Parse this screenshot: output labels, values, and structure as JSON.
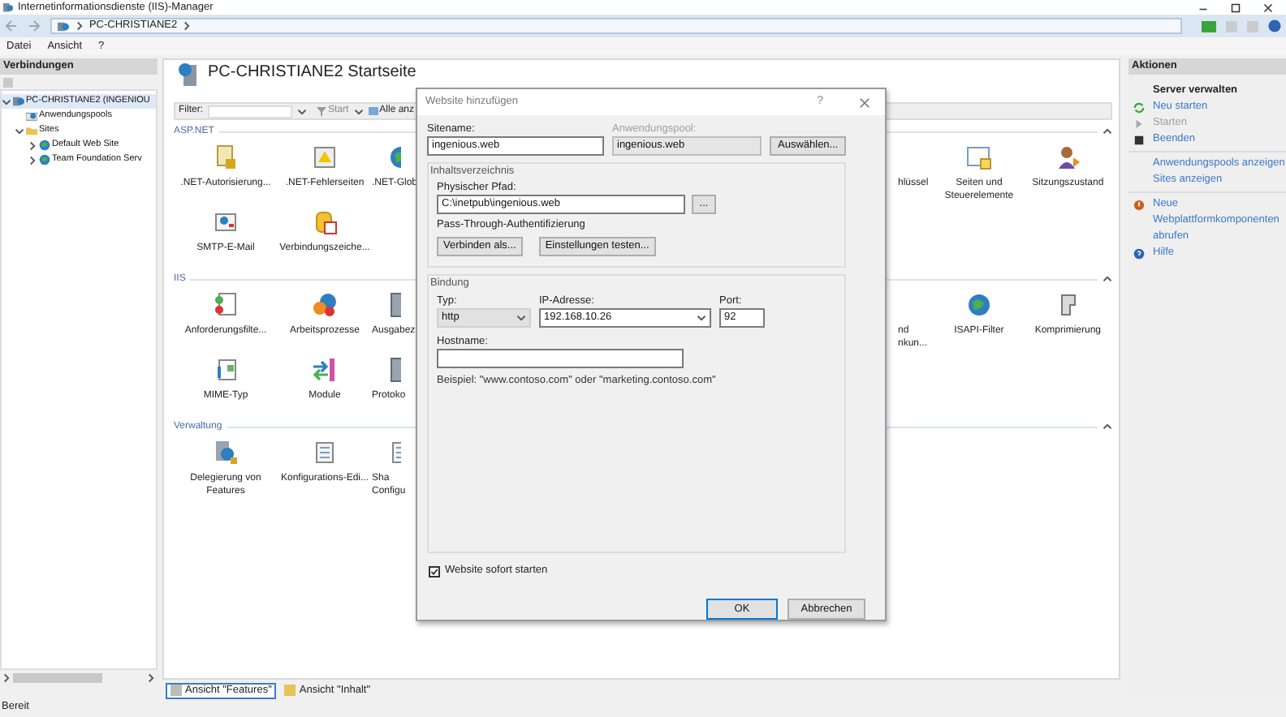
{
  "window": {
    "title": "Internetinformationsdienste (IIS)-Manager"
  },
  "address_bar": {
    "path": [
      {
        "label": "PC-CHRISTIANE2"
      }
    ]
  },
  "menu": [
    "Datei",
    "Ansicht",
    "?"
  ],
  "connections": {
    "title": "Verbindungen",
    "tree": [
      {
        "label": "PC-CHRISTIANE2 (INGENIOU",
        "expanded": true,
        "selected": true,
        "children": [
          {
            "label": "Anwendungspools",
            "selected": false
          },
          {
            "label": "Sites",
            "expanded": true,
            "selected": false,
            "children": [
              {
                "label": "Default Web Site",
                "expanded": false,
                "selected": false
              },
              {
                "label": "Team Foundation Serv",
                "expanded": false,
                "selected": false
              }
            ]
          }
        ]
      }
    ]
  },
  "start_page": {
    "title": "PC-CHRISTIANE2 Startseite",
    "filter": {
      "label": "Filter:",
      "start": "Start",
      "show_all": "Alle anz"
    },
    "groups": [
      {
        "title": "ASP.NET",
        "rows": [
          {
            "left": [
              {
                "label": ".NET-Autorisierung...",
                "kind": "feature"
              },
              {
                "label": ".NET-Fehlerseiten",
                "kind": "feature"
              },
              {
                "label": ".NET-Glob",
                "kind": "partial"
              }
            ],
            "right": [
              {
                "label": "hlüssel",
                "kind": "partial"
              },
              {
                "label": "Seiten und\nSteuerelemente",
                "kind": "feature"
              },
              {
                "label": "Sitzungszustand",
                "kind": "feature"
              }
            ]
          },
          {
            "left": [
              {
                "label": "SMTP-E-Mail",
                "kind": "feature"
              },
              {
                "label": "Verbindungszeiche...",
                "kind": "feature"
              }
            ],
            "right": []
          }
        ]
      },
      {
        "title": "IIS",
        "rows": [
          {
            "left": [
              {
                "label": "Anforderungsfilte...",
                "kind": "feature"
              },
              {
                "label": "Arbeitsprozesse",
                "kind": "feature"
              },
              {
                "label": "Ausgabez",
                "kind": "partial"
              }
            ],
            "right": [
              {
                "label": "nd\nnkun...",
                "kind": "partial"
              },
              {
                "label": "ISAPI-Filter",
                "kind": "feature"
              },
              {
                "label": "Komprimierung",
                "kind": "feature"
              }
            ]
          },
          {
            "left": [
              {
                "label": "MIME-Typ",
                "kind": "feature"
              },
              {
                "label": "Module",
                "kind": "feature"
              },
              {
                "label": "Protoko",
                "kind": "partial"
              }
            ],
            "right": []
          }
        ]
      },
      {
        "title": "Verwaltung",
        "rows": [
          {
            "left": [
              {
                "label": "Delegierung von\nFeatures",
                "kind": "feature"
              },
              {
                "label": "Konfigurations-Edi...",
                "kind": "feature"
              },
              {
                "label": "Sha\nConfigu",
                "kind": "partial"
              }
            ],
            "right": []
          }
        ]
      }
    ]
  },
  "dialog": {
    "title": "Website hinzufügen",
    "help": "?",
    "site_name": {
      "label": "Sitename:",
      "value": "ingenious.web"
    },
    "app_pool": {
      "label": "Anwendungspool:",
      "value": "ingenious.web",
      "disabled": true,
      "button": "Auswählen..."
    },
    "content_directory": {
      "title": "Inhaltsverzeichnis",
      "path_label": "Physischer Pfad:",
      "path": "C:\\inetpub\\ingenious.web",
      "browse_button": "...",
      "auth_label": "Pass-Through-Authentifizierung",
      "buttons": [
        "Verbinden als...",
        "Einstellungen testen..."
      ]
    },
    "binding": {
      "title": "Bindung",
      "type": {
        "label": "Typ:",
        "value": "http"
      },
      "ip": {
        "label": "IP-Adresse:",
        "value": "192.168.10.26"
      },
      "port": {
        "label": "Port:",
        "value": "92"
      },
      "hostname": {
        "label": "Hostname:"
      },
      "example": "Beispiel: \"www.contoso.com\" oder \"marketing.contoso.com\""
    },
    "start_now": {
      "label": "Website sofort starten",
      "checked": true
    },
    "buttons": [
      {
        "label": "OK",
        "default": true
      },
      {
        "label": "Abbrechen",
        "default": false
      }
    ]
  },
  "actions": {
    "title": "Aktionen",
    "sections": [
      {
        "heading": "Server verwalten",
        "items": [
          {
            "label": "Neu starten",
            "kind": "restart",
            "disabled": false
          },
          {
            "label": "Starten",
            "kind": "start",
            "disabled": true
          },
          {
            "label": "Beenden",
            "kind": "stop",
            "disabled": false
          }
        ]
      },
      {
        "items": [
          {
            "label": "Anwendungspools anzeigen",
            "kind": "link",
            "disabled": false
          },
          {
            "label": "Sites anzeigen",
            "kind": "link",
            "disabled": false
          }
        ]
      },
      {
        "items": [
          {
            "label": "Neue\nWebplattformkomponenten\nabrufen",
            "kind": "download",
            "disabled": false
          },
          {
            "label": "Hilfe",
            "kind": "help",
            "disabled": false
          }
        ]
      }
    ]
  },
  "view_tabs": [
    {
      "label": "Ansicht \"Features\"",
      "selected": true
    },
    {
      "label": "Ansicht \"Inhalt\"",
      "selected": false
    }
  ],
  "status_bar": {
    "text": "Bereit"
  }
}
